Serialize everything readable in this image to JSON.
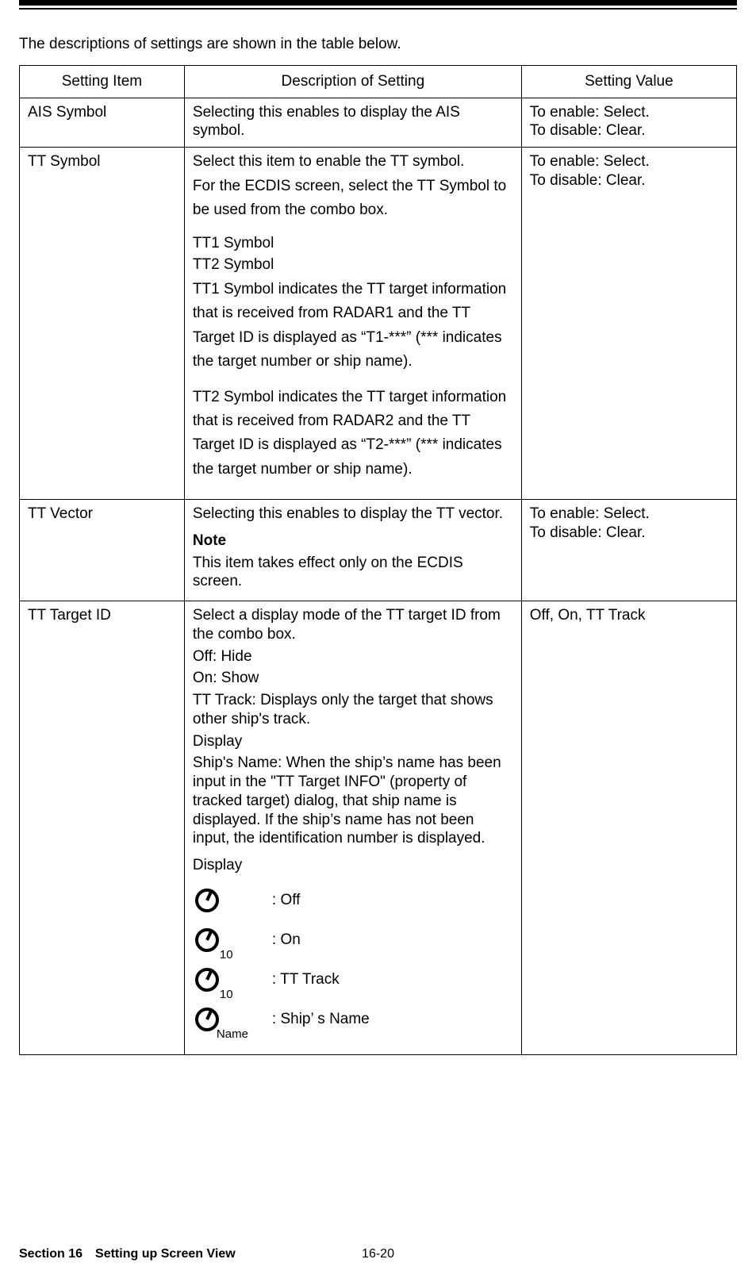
{
  "intro": "The descriptions of settings are shown in the table below.",
  "headers": {
    "item": "Setting Item",
    "desc": "Description of Setting",
    "value": "Setting Value"
  },
  "rows": {
    "ais": {
      "item": "AIS Symbol",
      "desc": "Selecting this enables to display the AIS symbol.",
      "val1": "To enable: Select.",
      "val2": "To disable: Clear."
    },
    "ttsym": {
      "item": "TT Symbol",
      "p1": "Select this item to enable the TT symbol.",
      "p2": "For the ECDIS screen, select the TT Symbol to be used from the combo box.",
      "p3": "TT1 Symbol",
      "p4": "TT2 Symbol",
      "p5": "TT1 Symbol indicates the TT target information that is received from RADAR1 and the TT Target ID is displayed as “T1-***” (*** indicates the target number or ship name).",
      "p6": "TT2 Symbol indicates the TT target information that is received from RADAR2 and the TT Target ID is displayed as “T2-***” (*** indicates the target number or ship name).",
      "val1": "To enable: Select.",
      "val2": "To disable: Clear."
    },
    "ttvec": {
      "item": "TT Vector",
      "p1": "Selecting this enables to display the TT vector.",
      "noteHead": "Note",
      "noteBody": "This item takes effect only on the ECDIS screen.",
      "val1": "To enable: Select.",
      "val2": "To disable: Clear."
    },
    "ttid": {
      "item": "TT Target ID",
      "p1": "Select a display mode of the TT target ID from the combo box.",
      "p2": "Off: Hide",
      "p3": "On: Show",
      "p4": "TT Track: Displays only the target that shows other ship's track.",
      "p5": "Display",
      "p6": "Ship's Name: When the ship’s name has been input in the \"TT Target INFO\" (property of tracked target) dialog, that ship name is displayed. If the ship’s name has not been input, the identification number is displayed.",
      "p7": "Display",
      "sym": {
        "offSub": "",
        "offLbl": ": Off",
        "onSub": "10",
        "onLbl": ": On",
        "ttSub": "10",
        "ttLbl": ": TT Track",
        "shipSub": "Name",
        "shipLbl": ": Ship’ s Name"
      },
      "val": "Off, On, TT Track"
    }
  },
  "footer": {
    "section": "Section 16 Setting up Screen View",
    "page": "16-20"
  }
}
